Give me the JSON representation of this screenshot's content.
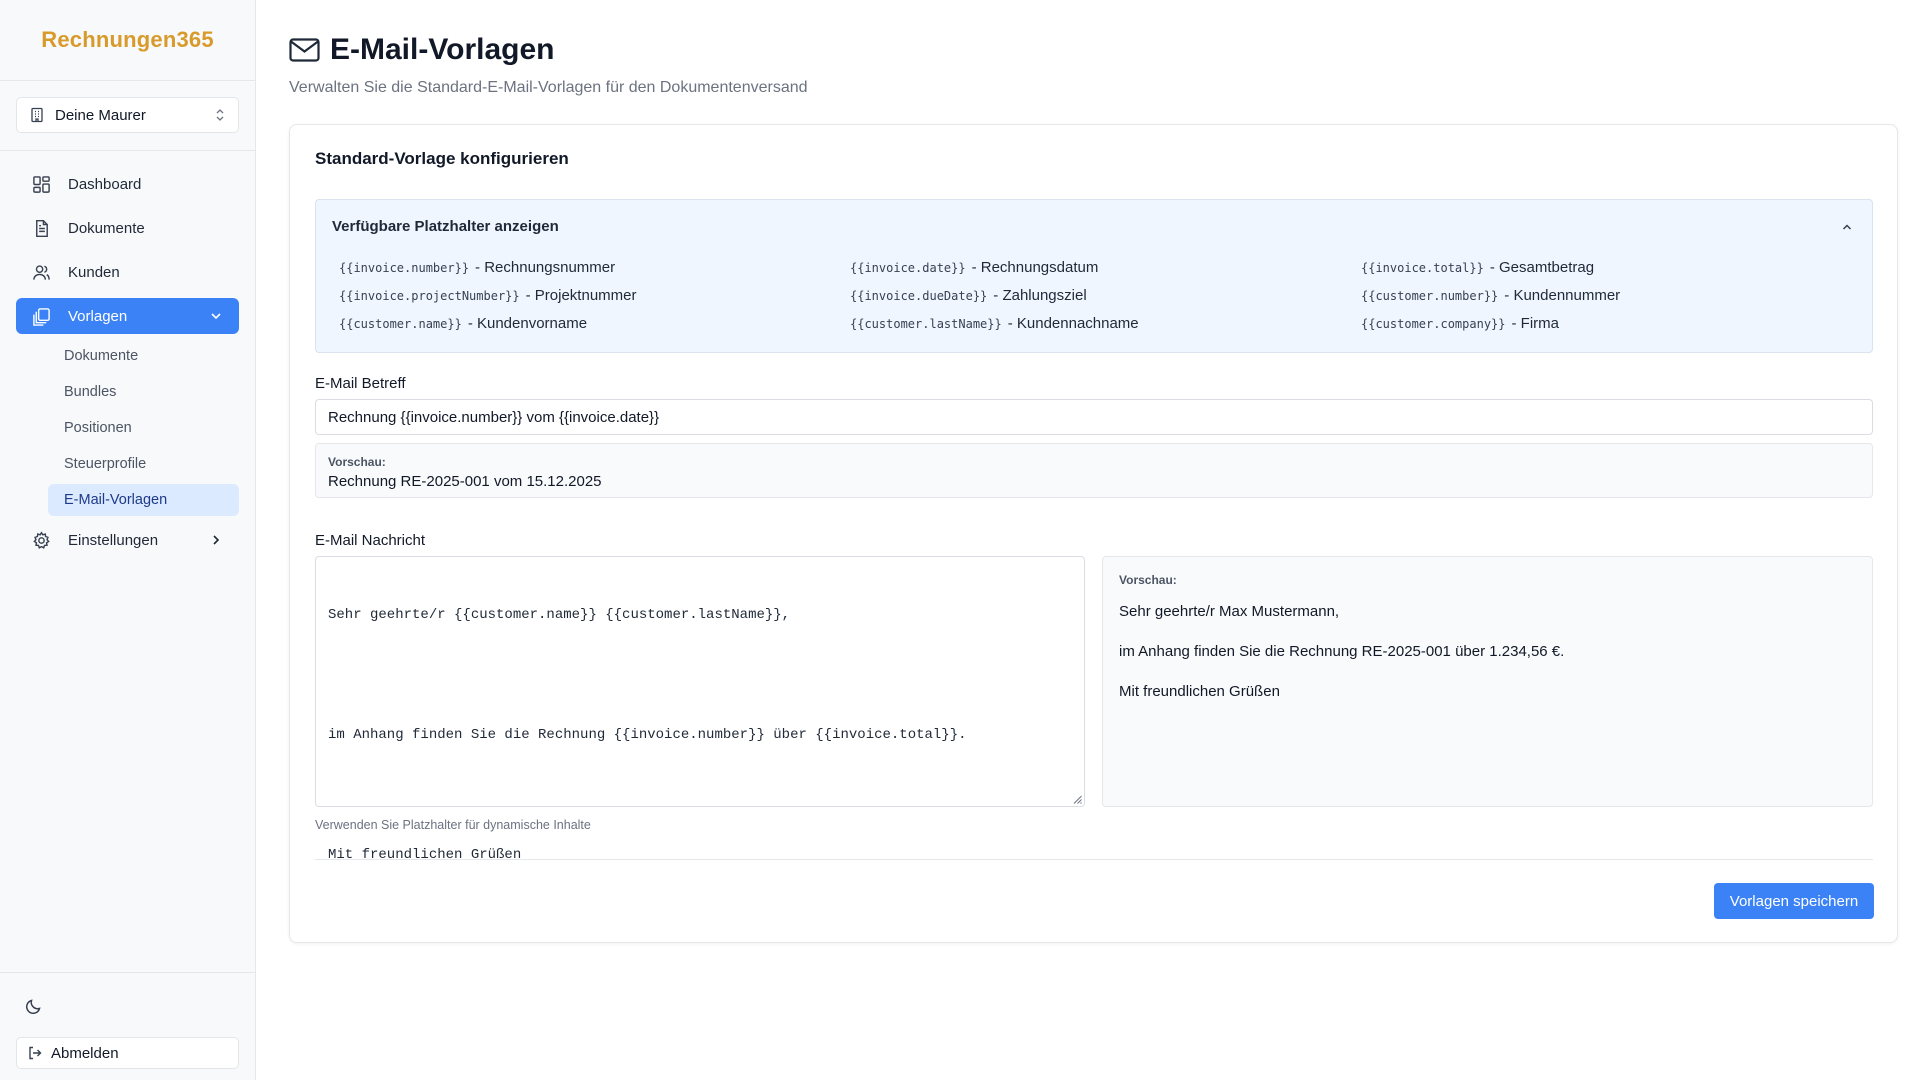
{
  "brand": "Rechnungen365",
  "org_select": {
    "value": "Deine Maurer"
  },
  "nav": {
    "items": [
      {
        "label": "Dashboard",
        "icon": "dashboard-icon"
      },
      {
        "label": "Dokumente",
        "icon": "document-icon"
      },
      {
        "label": "Kunden",
        "icon": "users-icon"
      },
      {
        "label": "Vorlagen",
        "icon": "templates-icon",
        "active": true
      },
      {
        "label": "Einstellungen",
        "icon": "gear-icon"
      }
    ],
    "sub_items": [
      "Dokumente",
      "Bundles",
      "Positionen",
      "Steuerprofile",
      "E-Mail-Vorlagen"
    ]
  },
  "logout_label": "Abmelden",
  "page": {
    "title": "E-Mail-Vorlagen",
    "subtitle": "Verwalten Sie die Standard-E-Mail-Vorlagen für den Dokumentenversand"
  },
  "card": {
    "title": "Standard-Vorlage konfigurieren",
    "placeholders_heading": "Verfügbare Platzhalter anzeigen",
    "placeholders": [
      {
        "code": "{{invoice.number}}",
        "desc": "- Rechnungsnummer"
      },
      {
        "code": "{{invoice.date}}",
        "desc": "- Rechnungsdatum"
      },
      {
        "code": "{{invoice.total}}",
        "desc": "- Gesamtbetrag"
      },
      {
        "code": "{{invoice.projectNumber}}",
        "desc": "- Projektnummer"
      },
      {
        "code": "{{invoice.dueDate}}",
        "desc": "- Zahlungsziel"
      },
      {
        "code": "{{customer.number}}",
        "desc": "- Kundennummer"
      },
      {
        "code": "{{customer.name}}",
        "desc": "- Kundenvorname"
      },
      {
        "code": "{{customer.lastName}}",
        "desc": "- Kundennachname"
      },
      {
        "code": "{{customer.company}}",
        "desc": "- Firma"
      }
    ],
    "subject_label": "E-Mail Betreff",
    "subject_value": "Rechnung {{invoice.number}} vom {{invoice.date}}",
    "preview_label": "Vorschau:",
    "subject_preview": "Rechnung RE-2025-001 vom 15.12.2025",
    "message_label": "E-Mail Nachricht",
    "message_lines": [
      "Sehr geehrte/r {{customer.name}} {{customer.lastName}},",
      "im Anhang finden Sie die Rechnung {{invoice.number}} über {{invoice.total}}.",
      "Mit freundlichen Grüßen"
    ],
    "message_preview_lines": [
      "Sehr geehrte/r Max Mustermann,",
      "im Anhang finden Sie die Rechnung RE-2025-001 über 1.234,56 €.",
      "Mit freundlichen Grüßen"
    ],
    "hint": "Verwenden Sie Platzhalter für dynamische Inhalte",
    "save_label": "Vorlagen speichern"
  },
  "colors": {
    "brand": "#d89b2b",
    "accent": "#3b82f6",
    "active_sub_bg": "#dbeafe",
    "placeholder_bg": "#eff6ff"
  }
}
